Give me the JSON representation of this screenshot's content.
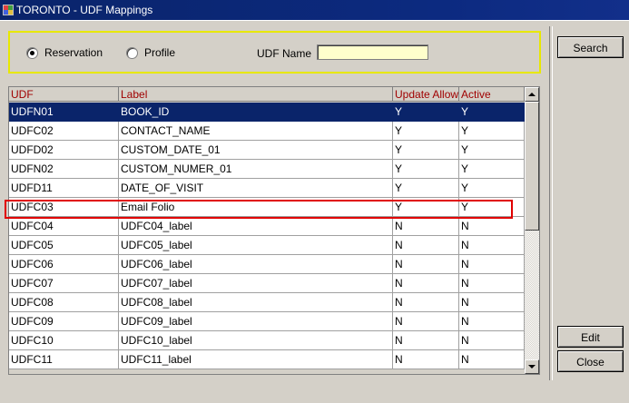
{
  "window": {
    "title": "TORONTO - UDF Mappings"
  },
  "filter": {
    "options": [
      {
        "label": "Reservation",
        "selected": true
      },
      {
        "label": "Profile",
        "selected": false
      }
    ],
    "udf_name_label": "UDF Name",
    "udf_name_value": ""
  },
  "table": {
    "headers": [
      "UDF",
      "Label",
      "Update Allow",
      "Active"
    ],
    "rows": [
      [
        "UDFN01",
        "BOOK_ID",
        "Y",
        "Y"
      ],
      [
        "UDFC02",
        "CONTACT_NAME",
        "Y",
        "Y"
      ],
      [
        "UDFD02",
        "CUSTOM_DATE_01",
        "Y",
        "Y"
      ],
      [
        "UDFN02",
        "CUSTOM_NUMER_01",
        "Y",
        "Y"
      ],
      [
        "UDFD11",
        "DATE_OF_VISIT",
        "Y",
        "Y"
      ],
      [
        "UDFC03",
        "Email Folio",
        "Y",
        "Y"
      ],
      [
        "UDFC04",
        "UDFC04_label",
        "N",
        "N"
      ],
      [
        "UDFC05",
        "UDFC05_label",
        "N",
        "N"
      ],
      [
        "UDFC06",
        "UDFC06_label",
        "N",
        "N"
      ],
      [
        "UDFC07",
        "UDFC07_label",
        "N",
        "N"
      ],
      [
        "UDFC08",
        "UDFC08_label",
        "N",
        "N"
      ],
      [
        "UDFC09",
        "UDFC09_label",
        "N",
        "N"
      ],
      [
        "UDFC10",
        "UDFC10_label",
        "N",
        "N"
      ],
      [
        "UDFC11",
        "UDFC11_label",
        "N",
        "N"
      ]
    ],
    "selected_row": 0,
    "highlighted_row": 5
  },
  "buttons": {
    "search": "Search",
    "edit": "Edit",
    "close": "Close"
  },
  "colors": {
    "title_bar": "#0a246a",
    "selection": "#0a246a",
    "header_text": "#a00000",
    "input_bg": "#ffffcc",
    "filter_border": "#e8e800",
    "highlight_border": "#e00000"
  }
}
